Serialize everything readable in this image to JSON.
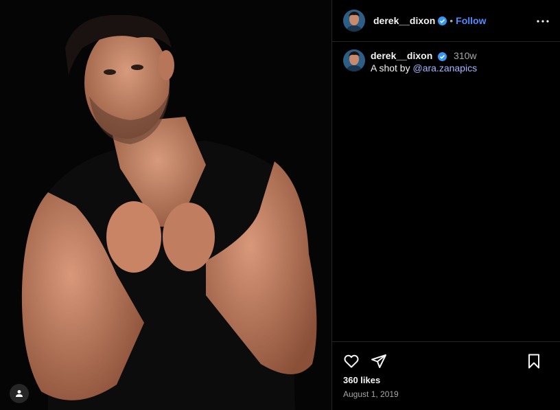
{
  "post": {
    "media": {
      "tag_icon": "user-tag-icon",
      "description_colors": {
        "background": "#000000",
        "skin": "#c8896a",
        "shirt": "#0b0b0b",
        "hair": "#1a1210"
      }
    },
    "header": {
      "username": "derek__dixon",
      "verified_icon": "verified-badge-icon",
      "separator": "•",
      "follow_label": "Follow",
      "more_icon": "more-horizontal-icon"
    },
    "caption": {
      "username": "derek__dixon",
      "time": "310w",
      "text_prefix": "A shot by ",
      "mention": "@ara.zanapics"
    },
    "footer": {
      "like_icon": "heart-icon",
      "share_icon": "send-icon",
      "save_icon": "bookmark-icon",
      "likes": "360 likes",
      "date": "August 1, 2019"
    }
  },
  "colors": {
    "background": "#000000",
    "text": "#f5f5f5",
    "secondary_text": "#a8a8a8",
    "follow": "#4d8dff",
    "mention": "#a5b8ff",
    "verified": "#3897f0",
    "divider": "#262626"
  }
}
